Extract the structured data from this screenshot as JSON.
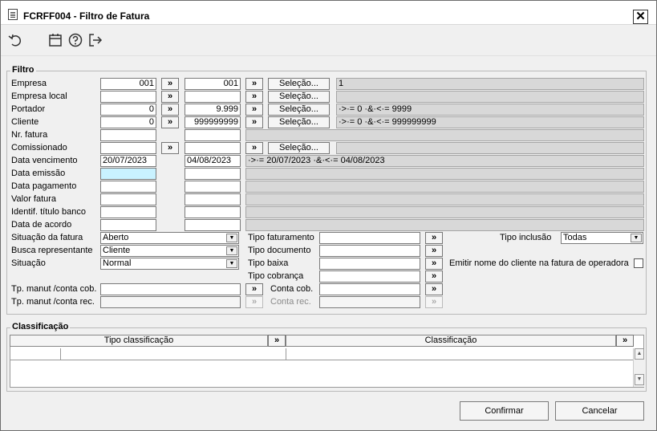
{
  "window": {
    "title": "FCRFF004 - Filtro de Fatura",
    "close": "✕"
  },
  "toolbar": {
    "icons": [
      "undo-icon",
      "calendar-icon",
      "help-icon",
      "exit-icon"
    ]
  },
  "filtro": {
    "title": "Filtro",
    "labels": {
      "empresa": "Empresa",
      "empresa_local": "Empresa local",
      "portador": "Portador",
      "cliente": "Cliente",
      "nr_fatura": "Nr. fatura",
      "comissionado": "Comissionado",
      "data_vencimento": "Data vencimento",
      "data_emissao": "Data emissão",
      "data_pagamento": "Data pagamento",
      "valor_fatura": "Valor fatura",
      "identif": "Identif. título banco",
      "data_acordo": "Data de acordo",
      "situacao_fatura": "Situação da fatura",
      "busca_rep": "Busca representante",
      "situacao": "Situação",
      "tp_cob": "Tp. manut /conta cob.",
      "tp_rec": "Tp. manut /conta rec.",
      "tipo_faturamento": "Tipo faturamento",
      "tipo_documento": "Tipo documento",
      "tipo_baixa": "Tipo baixa",
      "tipo_cobranca": "Tipo cobrança",
      "conta_cob": "Conta cob.",
      "conta_rec": "Conta rec.",
      "tipo_inclusao": "Tipo inclusão",
      "emitir": "Emitir nome do cliente na fatura de operadora"
    },
    "arrow": "»",
    "selecao": "Seleção...",
    "empresa": {
      "from": "001",
      "to": "001",
      "desc": "1"
    },
    "portador": {
      "from": "0",
      "to": "9.999",
      "desc": "·>·= 0 ·&·<·= 9999"
    },
    "cliente": {
      "from": "0",
      "to": "999999999",
      "desc": "·>·= 0 ·&·<·= 999999999"
    },
    "data_vencimento": {
      "from": "20/07/2023",
      "to": "04/08/2023",
      "desc": "·>·= 20/07/2023 ·&·<·= 04/08/2023"
    },
    "situacao_fatura": "Aberto",
    "busca_rep": "Cliente",
    "situacao": "Normal",
    "tipo_inclusao": "Todas"
  },
  "classificacao": {
    "title": "Classificação",
    "col1": "Tipo classificação",
    "col2": "Classificação"
  },
  "buttons": {
    "confirmar": "Confirmar",
    "cancelar": "Cancelar"
  }
}
